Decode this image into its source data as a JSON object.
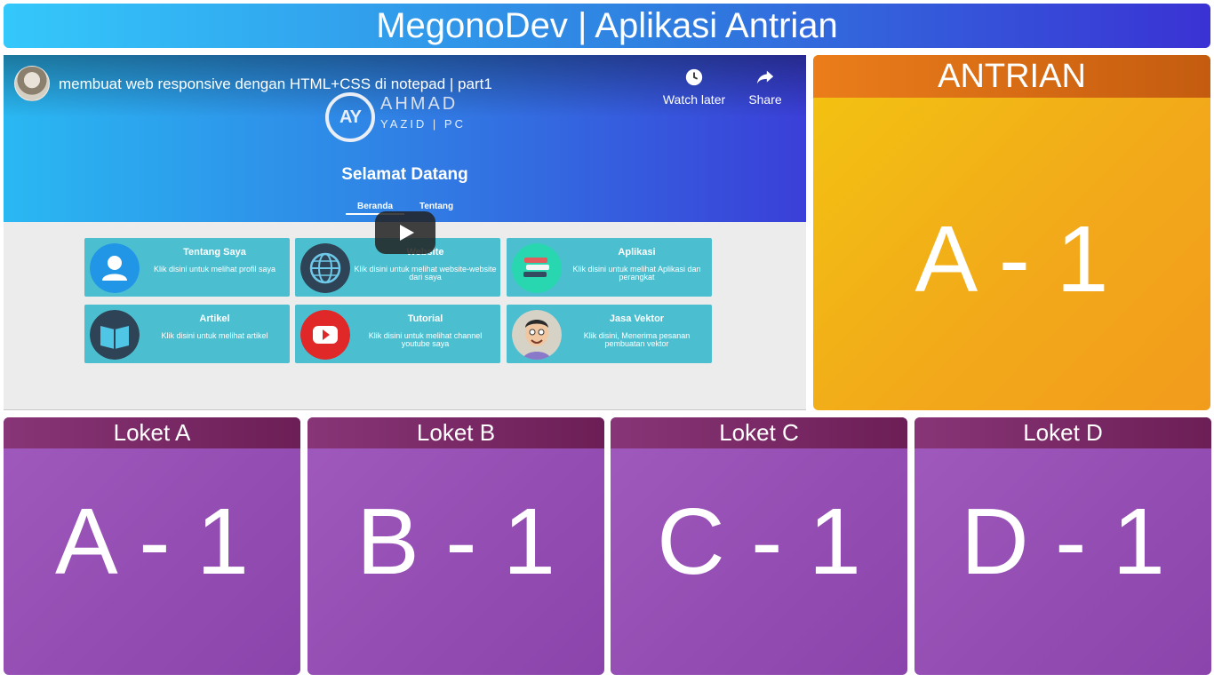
{
  "app": {
    "title": "MegonoDev | Aplikasi Antrian"
  },
  "video": {
    "title": "membuat web responsive dengan HTML+CSS di notepad | part1",
    "actions": {
      "watch_later": "Watch later",
      "share": "Share"
    },
    "content": {
      "logo_initials": "AY",
      "logo_name": "AHMAD",
      "logo_sub": "YAZID | PC",
      "welcome": "Selamat Datang",
      "nav": [
        "Beranda",
        "Tentang"
      ],
      "cards": [
        {
          "title": "Tentang Saya",
          "desc": "Klik disini untuk melihat profil saya",
          "icon": "user-icon",
          "color": "#2196e6"
        },
        {
          "title": "Website",
          "desc": "Klik disini untuk melihat website-website dari saya",
          "icon": "globe-icon",
          "color": "#2e4356"
        },
        {
          "title": "Aplikasi",
          "desc": "Klik disini untuk melihat Aplikasi dan perangkat",
          "icon": "books-icon",
          "color": "#28d6b0"
        },
        {
          "title": "Artikel",
          "desc": "Klik disini untuk melihat artikel",
          "icon": "book-icon",
          "color": "#2e4356"
        },
        {
          "title": "Tutorial",
          "desc": "Klik disini untuk melihat channel youtube saya",
          "icon": "youtube-icon",
          "color": "#e02828"
        },
        {
          "title": "Jasa Vektor",
          "desc": "Klik disini, Menerima pesanan pembuatan vektor",
          "icon": "avatar-vector-icon",
          "color": "#c9c2b4"
        }
      ]
    }
  },
  "antrian": {
    "label": "ANTRIAN",
    "number": "A - 1"
  },
  "lokets": [
    {
      "label": "Loket A",
      "number": "A - 1"
    },
    {
      "label": "Loket B",
      "number": "B - 1"
    },
    {
      "label": "Loket C",
      "number": "C - 1"
    },
    {
      "label": "Loket D",
      "number": "D - 1"
    }
  ]
}
